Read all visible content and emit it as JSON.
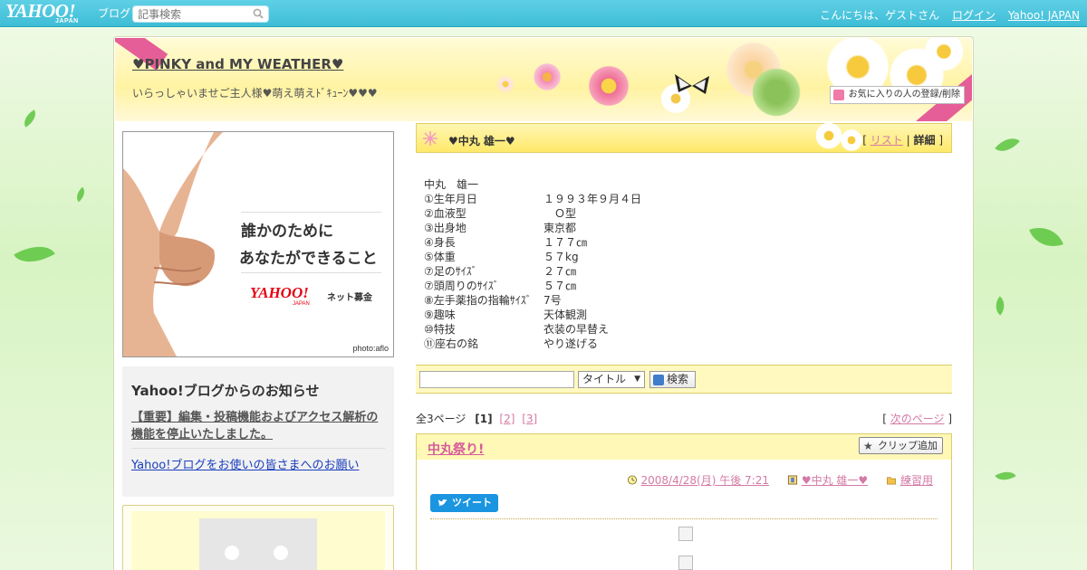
{
  "topbar": {
    "logo_text": "YAHOO!",
    "logo_sub": "JAPAN",
    "blog_text": "ブログ",
    "search_placeholder": "記事検索",
    "greeting": "こんにちは、ゲストさん",
    "login": "ログイン",
    "yahoo_japan": "Yahoo! JAPAN"
  },
  "header": {
    "blog_title": "♥PINKY and MY WEATHER♥",
    "subtitle": "いらっしゃいませご主人様♥萌え萌えﾄﾞｷｭｰﾝ♥♥♥",
    "favorite_button": "お気に入りの人の登録/削除"
  },
  "banner": {
    "line1": "誰かのために",
    "line2": "あなたができること",
    "logo": "YAHOO!",
    "logo_sub": "JAPAN",
    "tagline": "ネット募金",
    "credit": "photo:aflo"
  },
  "notice": {
    "heading": "Yahoo!ブログからのお知らせ",
    "item1": "【重要】編集・投稿機能およびアクセス解析の機能を停止いたしました。",
    "item2": "Yahoo!ブログをお使いの皆さまへのお願い"
  },
  "article_header": {
    "name": "♥中丸 雄一♥",
    "bracket_open": "[ ",
    "list": "リスト",
    "separator": " | ",
    "detail": "詳細",
    "bracket_close": " ]"
  },
  "profile": {
    "name": "中丸　雄一",
    "rows": [
      {
        "k": "①生年月日",
        "v": "１９９３年９月４日"
      },
      {
        "k": "②血液型",
        "v": "　Ｏ型"
      },
      {
        "k": "③出身地",
        "v": "東京都"
      },
      {
        "k": "④身長",
        "v": "１７７㎝"
      },
      {
        "k": "⑤体重",
        "v": "５７kg"
      },
      {
        "k": "⑦足のｻｲｽﾞ",
        "v": "２７㎝"
      },
      {
        "k": "⑦頭周りのｻｲｽﾞ",
        "v": "５７㎝"
      },
      {
        "k": "⑧左手薬指の指輪ｻｲｽﾞ",
        "v": "7号"
      },
      {
        "k": "⑨趣味",
        "v": "天体観測"
      },
      {
        "k": "⑩特技",
        "v": "衣装の早替え"
      },
      {
        "k": "⑪座右の銘",
        "v": "やり遂げる"
      }
    ]
  },
  "search": {
    "select_value": "タイトル",
    "button": "検索"
  },
  "pager": {
    "total": "全3ページ",
    "current": "[1]",
    "p2": "[2]",
    "p3": "[3]",
    "next_open": "[ ",
    "next": "次のページ",
    "next_close": " ]"
  },
  "entry": {
    "title": "中丸祭り!",
    "clip": "クリップ追加",
    "date": "2008/4/28(月) 午後 7:21",
    "author": "♥中丸 雄一♥",
    "category": "練習用",
    "tweet": "ツイート"
  },
  "colors": {
    "topbar": "#45c2da",
    "accent_pink": "#d65b9b",
    "header_yellow": "#ffef8a",
    "link_blue": "#1a3ebd"
  }
}
